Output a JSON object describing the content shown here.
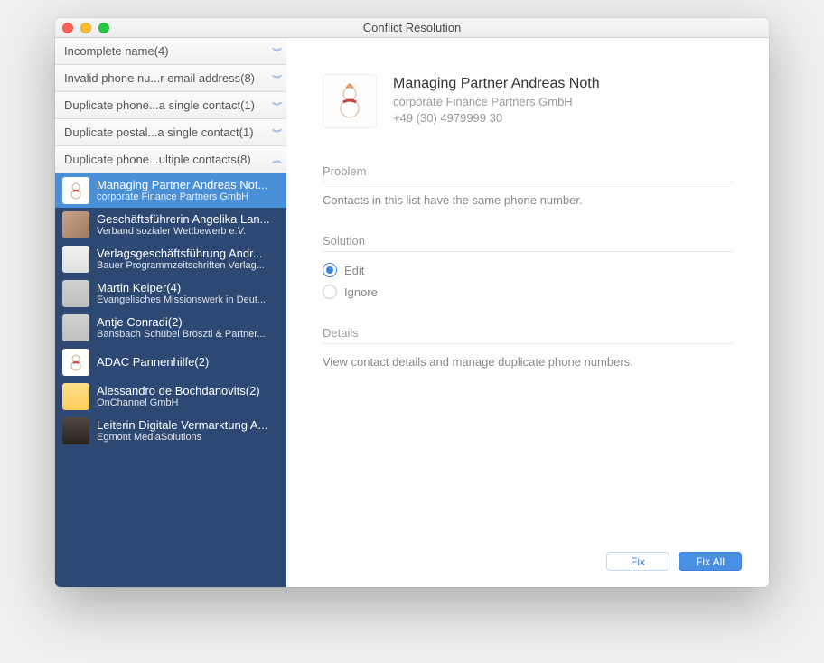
{
  "window": {
    "title": "Conflict Resolution"
  },
  "sidebar": {
    "categories": [
      {
        "label": "Incomplete name(4)"
      },
      {
        "label": "Invalid phone nu...r email address(8)"
      },
      {
        "label": "Duplicate phone...a single contact(1)"
      },
      {
        "label": "Duplicate postal...a single contact(1)"
      },
      {
        "label": "Duplicate phone...ultiple contacts(8)"
      }
    ],
    "contacts": [
      {
        "name": "Managing Partner Andreas Not...",
        "sub": "corporate Finance Partners GmbH"
      },
      {
        "name": "Geschäftsführerin Angelika Lan...",
        "sub": "Verband sozialer Wettbewerb e.V."
      },
      {
        "name": "Verlagsgeschäftsführung Andr...",
        "sub": "Bauer Programmzeitschriften Verlag..."
      },
      {
        "name": "Martin Keiper(4)",
        "sub": "Evangelisches Missionswerk in Deut..."
      },
      {
        "name": "Antje Conradi(2)",
        "sub": "Bansbach Schübel Brösztl & Partner..."
      },
      {
        "name": "ADAC Pannenhilfe(2)",
        "sub": ""
      },
      {
        "name": "Alessandro de Bochdanovits(2)",
        "sub": "OnChannel GmbH"
      },
      {
        "name": "Leiterin Digitale Vermarktung A...",
        "sub": "Egmont MediaSolutions"
      }
    ]
  },
  "detail": {
    "name": "Managing Partner Andreas Noth",
    "company": "corporate Finance Partners GmbH",
    "phone": "+49 (30) 4979999 30",
    "problem": {
      "title": "Problem",
      "text": "Contacts in this list have the same phone number."
    },
    "solution": {
      "title": "Solution",
      "options": {
        "edit": "Edit",
        "ignore": "Ignore"
      }
    },
    "details": {
      "title": "Details",
      "text": "View contact details and manage duplicate phone numbers."
    }
  },
  "buttons": {
    "fix": "Fix",
    "fixAll": "Fix All"
  }
}
